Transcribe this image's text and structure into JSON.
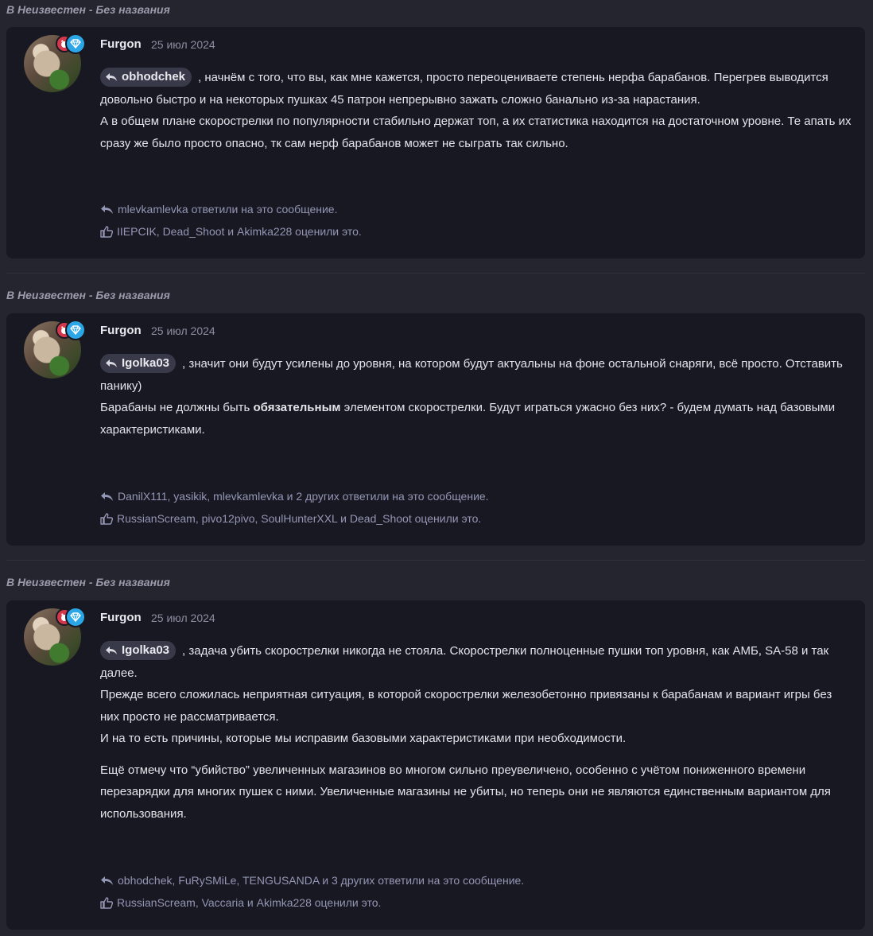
{
  "posts": [
    {
      "section_prefix": "В",
      "section_name": "Неизвестен - Без названия",
      "author": "Furgon",
      "date": "25 июл 2024",
      "mention": "obhodchek",
      "lines": [
        ", начнём с того, что вы, как мне кажется, просто переоцениваете степень нерфа барабанов. Перегрев выводится довольно быстро и на некоторых пушках 45 патрон непрерывно зажать сложно банально из-за нарастания.",
        "А в общем плане скорострелки по популярности стабильно держат топ, а их статистика находится на достаточном уровне. Те апать их сразу же было просто опасно, тк сам нерф барабанов может не сыграть так сильно."
      ],
      "replies": "mlevkamlevka ответили на это сообщение.",
      "likes": "IIEPCIK, Dead_Shoot и Akimka228 оценили это."
    },
    {
      "section_prefix": "В",
      "section_name": "Неизвестен - Без названия",
      "author": "Furgon",
      "date": "25 июл 2024",
      "mention": "Igolka03",
      "line1": ", значит они будут усилены до уровня, на котором будут актуальны на фоне остальной снаряги, всё просто. Отставить панику)",
      "line2_a": "Барабаны не должны быть ",
      "line2_bold": "обязательным",
      "line2_b": " элементом скорострелки. Будут играться ужасно без них? - будем думать над базовыми характеристиками.",
      "replies": "DanilX111, yasikik, mlevkamlevka и 2 других ответили на это сообщение.",
      "likes": "RussianScream, pivo12pivo, SoulHunterXXL и Dead_Shoot оценили это."
    },
    {
      "section_prefix": "В",
      "section_name": "Неизвестен - Без названия",
      "author": "Furgon",
      "date": "25 июл 2024",
      "mention": "Igolka03",
      "lines": [
        ", задача убить скорострелки никогда не стояла. Скорострелки полноценные пушки топ уровня, как АМБ, SA-58 и так далее.",
        "Прежде всего сложилась неприятная ситуация, в которой скорострелки железобетонно привязаны к барабанам и вариант игры без них просто не рассматривается.",
        "И на то есть причины, которые мы исправим базовыми характеристиками при необходимости.",
        "Ещё отмечу что “убийство” увеличенных магазинов во многом сильно преувеличено, особенно с учётом пониженного времени перезарядки для многих пушек с ними. Увеличенные магазины не убиты, но теперь они не являются единственным вариантом для использования."
      ],
      "replies": "obhodchek, FuRySMiLe, TENGUSANDA и 3 других ответили на это сообщение.",
      "likes": "RussianScream, Vaccaria и Akimka228 оценили это."
    }
  ],
  "colors": {
    "page_bg": "#24252f",
    "card_bg": "#171821",
    "mention_bg": "#393a49",
    "meta_text": "#9496b5",
    "badge_red": "#d4384a",
    "badge_blue": "#2ba7e8"
  },
  "icons": [
    "reply-icon",
    "like-icon",
    "diamond-icon",
    "cat-badge-icon"
  ]
}
